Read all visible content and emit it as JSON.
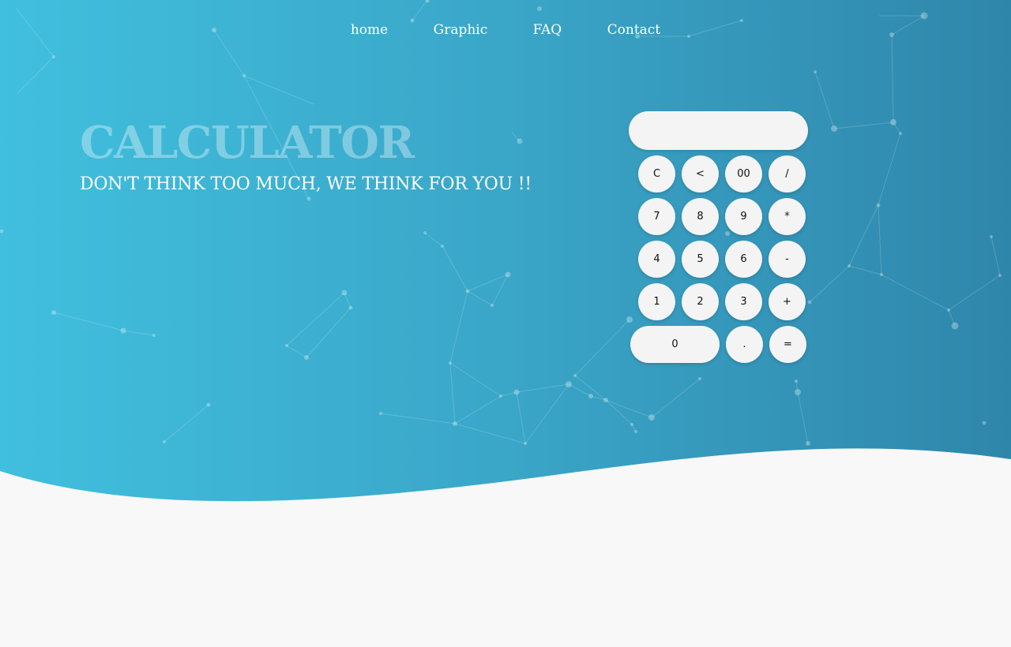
{
  "nav": {
    "items": [
      "home",
      "Graphic",
      "FAQ",
      "Contact"
    ]
  },
  "hero": {
    "title": "CALCULATOR",
    "subtitle": "DON'T THINK TOO MUCH, WE THINK FOR YOU !!"
  },
  "calculator": {
    "display_value": "",
    "keys": [
      [
        "C",
        "<",
        "00",
        "/"
      ],
      [
        "7",
        "8",
        "9",
        "*"
      ],
      [
        "4",
        "5",
        "6",
        "-"
      ],
      [
        "1",
        "2",
        "3",
        "+"
      ],
      [
        "0",
        ".",
        "="
      ]
    ]
  },
  "colors": {
    "gradient_start": "#41bfde",
    "gradient_end": "#2f86ab",
    "page_background": "#f8f8f8",
    "button": "#f4f4f4"
  }
}
